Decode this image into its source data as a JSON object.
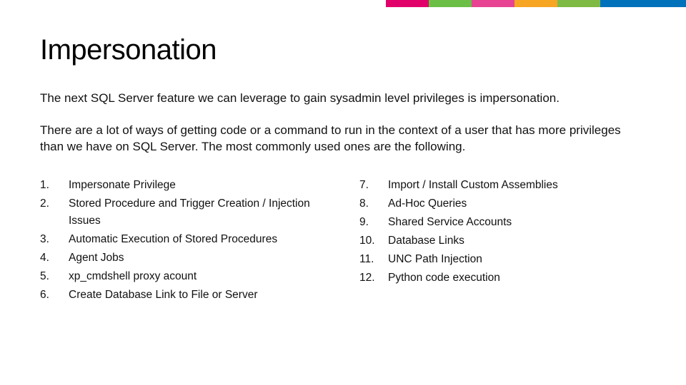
{
  "stripe_colors": [
    "#e1006a",
    "#6bbf46",
    "#e84393",
    "#f6a623",
    "#7fba44",
    "#0072bc"
  ],
  "stripe_widths": [
    60,
    60,
    60,
    60,
    60,
    120
  ],
  "title": "Impersonation",
  "para1": "The next SQL Server feature we can leverage to gain sysadmin level privileges is impersonation.",
  "para2": "There are a lot of ways of getting code or a command to run in the context of a user that has more privileges than we have on SQL Server. The most commonly used ones are the following.",
  "left": [
    {
      "n": "1.",
      "t": "Impersonate Privilege"
    },
    {
      "n": "2.",
      "t": "Stored Procedure and Trigger Creation / Injection Issues"
    },
    {
      "n": "3.",
      "t": "Automatic Execution of Stored Procedures"
    },
    {
      "n": "4.",
      "t": "Agent Jobs"
    },
    {
      "n": "5.",
      "t": "xp_cmdshell proxy acount"
    },
    {
      "n": "6.",
      "t": "Create Database Link to File or Server"
    }
  ],
  "right": [
    {
      "n": "7.",
      "t": "Import / Install Custom Assemblies"
    },
    {
      "n": "8.",
      "t": "Ad-Hoc Queries"
    },
    {
      "n": "9.",
      "t": "Shared Service Accounts"
    },
    {
      "n": "10.",
      "t": "Database Links"
    },
    {
      "n": "11.",
      "t": "UNC Path Injection"
    },
    {
      "n": "12.",
      "t": "Python code execution"
    }
  ]
}
